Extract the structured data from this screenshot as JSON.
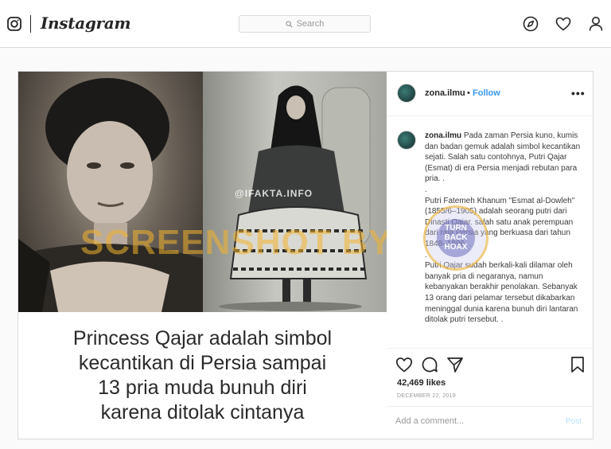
{
  "colors": {
    "accent": "#3897f0",
    "post_disabled": "#b2dffc",
    "border": "#dbdbdb",
    "watermark": "#f3b22d"
  },
  "nav": {
    "wordmark": "Instagram",
    "search_placeholder": "Search",
    "icons": [
      "instagram-camera-icon",
      "search-icon",
      "explore-compass-icon",
      "activity-heart-icon",
      "profile-person-icon"
    ]
  },
  "post": {
    "image": {
      "caption_lines": [
        "Princess Qajar adalah simbol",
        "kecantikan di Persia sampai",
        "13 pria muda bunuh diri",
        "karena ditolak cintanya"
      ],
      "watermark": "SCREENSHOT BY",
      "overlay_handle": "@IFAKTA.INFO"
    },
    "header": {
      "username": "zona.ilmu",
      "separator": "•",
      "follow_label": "Follow",
      "more_label": "•••"
    },
    "caption": {
      "username": "zona.ilmu",
      "paragraph_1": "Pada zaman Persia kuno, kumis dan badan gemuk adalah simbol kecantikan sejati. Salah satu contohnya, Putri Qajar (Esmat) di era Persia menjadi rebutan para pria. .",
      "spacer_1": ".",
      "paragraph_2": "Putri Fatemeh Khanum \"Esmat al-Dowleh\" (1855/6–1905) adalah seorang putri dari Dinasti Qajar. salah satu anak perempuan dari raja Persia yang berkuasa dari tahun 1848–1896. .",
      "spacer_2": ".",
      "paragraph_3": "Putri Qajar sudah berkali-kali dilamar oleh banyak pria di negaranya, namun kebanyakan berakhir penolakan. Sebanyak 13 orang dari pelamar tersebut dikabarkan meninggal dunia karena bunuh diri lantaran ditolak putri tersebut. ."
    },
    "stamp": {
      "line_1": "TURN",
      "line_2": "BACK",
      "line_3": "HOAX"
    },
    "action_icons": [
      "like-heart-icon",
      "comment-bubble-icon",
      "share-plane-icon",
      "save-bookmark-icon"
    ],
    "likes": "42,469 likes",
    "date": "DECEMBER 22, 2019",
    "comment_placeholder": "Add a comment...",
    "post_button": "Post"
  }
}
